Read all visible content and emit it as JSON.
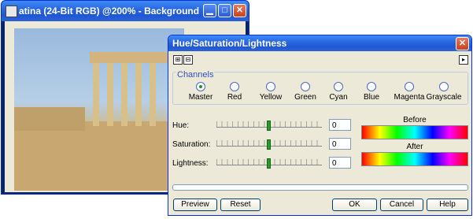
{
  "image_window": {
    "title": "atina (24-Bit RGB) @200% - Background",
    "min_glyph": "▁",
    "max_glyph": "□",
    "close_glyph": "✕"
  },
  "dialog": {
    "title": "Hue/Saturation/Lightness",
    "close_glyph": "✕",
    "left_buttons": [
      "⊞",
      "⊟"
    ],
    "menu_arrow": "▸",
    "channels": {
      "legend": "Channels",
      "items": [
        {
          "label": "Master",
          "selected": true
        },
        {
          "label": "Red",
          "selected": false
        },
        {
          "label": "Yellow",
          "selected": false
        },
        {
          "label": "Green",
          "selected": false
        },
        {
          "label": "Cyan",
          "selected": false
        },
        {
          "label": "Blue",
          "selected": false
        },
        {
          "label": "Magenta",
          "selected": false
        },
        {
          "label": "Grayscale",
          "selected": false
        }
      ]
    },
    "sliders": [
      {
        "label": "Hue:",
        "value": "0"
      },
      {
        "label": "Saturation:",
        "value": "0"
      },
      {
        "label": "Lightness:",
        "value": "0"
      }
    ],
    "before_label": "Before",
    "after_label": "After",
    "buttons": {
      "preview": "Preview",
      "reset": "Reset",
      "ok": "OK",
      "cancel": "Cancel",
      "help": "Help"
    }
  },
  "colors": {
    "titlebar": "#2a68e0",
    "dialog_bg": "#ece9d8",
    "close_red": "#c9411f"
  }
}
